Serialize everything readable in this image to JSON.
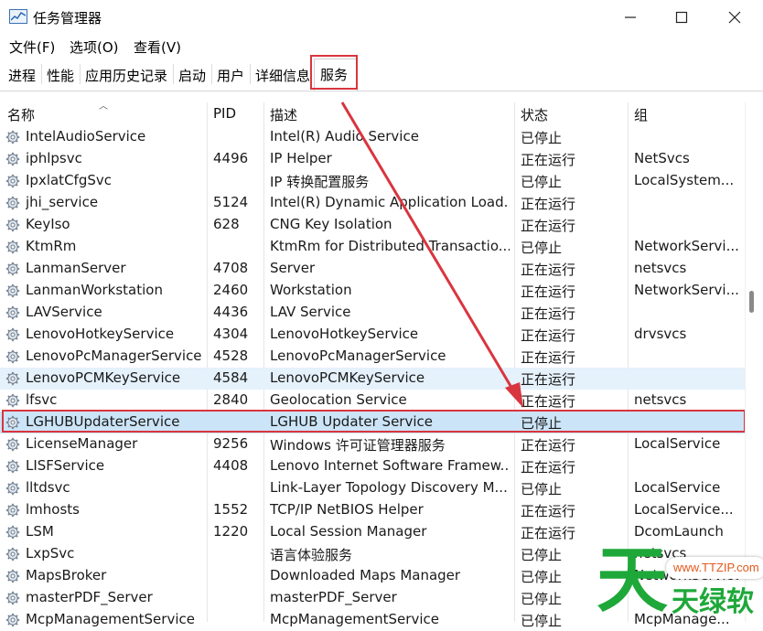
{
  "window": {
    "title": "任务管理器"
  },
  "menu": [
    "文件(F)",
    "选项(O)",
    "查看(V)"
  ],
  "tabs": [
    "进程",
    "性能",
    "应用历史记录",
    "启动",
    "用户",
    "详细信息",
    "服务"
  ],
  "active_tab": "服务",
  "columns": [
    "名称",
    "PID",
    "描述",
    "状态",
    "组"
  ],
  "rows": [
    {
      "name": "IntelAudioService",
      "pid": "",
      "desc": "Intel(R) Audio Service",
      "status": "已停止",
      "group": ""
    },
    {
      "name": "iphlpsvc",
      "pid": "4496",
      "desc": "IP Helper",
      "status": "正在运行",
      "group": "NetSvcs"
    },
    {
      "name": "IpxlatCfgSvc",
      "pid": "",
      "desc": "IP 转换配置服务",
      "status": "已停止",
      "group": "LocalSystem..."
    },
    {
      "name": "jhi_service",
      "pid": "5124",
      "desc": "Intel(R) Dynamic Application Load...",
      "status": "正在运行",
      "group": ""
    },
    {
      "name": "KeyIso",
      "pid": "628",
      "desc": "CNG Key Isolation",
      "status": "正在运行",
      "group": ""
    },
    {
      "name": "KtmRm",
      "pid": "",
      "desc": "KtmRm for Distributed Transactio...",
      "status": "已停止",
      "group": "NetworkServi..."
    },
    {
      "name": "LanmanServer",
      "pid": "4708",
      "desc": "Server",
      "status": "正在运行",
      "group": "netsvcs"
    },
    {
      "name": "LanmanWorkstation",
      "pid": "2460",
      "desc": "Workstation",
      "status": "正在运行",
      "group": "NetworkServi..."
    },
    {
      "name": "LAVService",
      "pid": "4436",
      "desc": "LAV Service",
      "status": "正在运行",
      "group": ""
    },
    {
      "name": "LenovoHotkeyService",
      "pid": "4304",
      "desc": "LenovoHotkeyService",
      "status": "正在运行",
      "group": "drvsvcs"
    },
    {
      "name": "LenovoPcManagerService",
      "pid": "4528",
      "desc": "LenovoPcManagerService",
      "status": "正在运行",
      "group": ""
    },
    {
      "name": "LenovoPCMKeyService",
      "pid": "4584",
      "desc": "LenovoPCMKeyService",
      "status": "正在运行",
      "group": ""
    },
    {
      "name": "lfsvc",
      "pid": "2840",
      "desc": "Geolocation Service",
      "status": "正在运行",
      "group": "netsvcs"
    },
    {
      "name": "LGHUBUpdaterService",
      "pid": "",
      "desc": "LGHUB Updater Service",
      "status": "已停止",
      "group": ""
    },
    {
      "name": "LicenseManager",
      "pid": "9256",
      "desc": "Windows 许可证管理器服务",
      "status": "正在运行",
      "group": "LocalService"
    },
    {
      "name": "LISFService",
      "pid": "4408",
      "desc": "Lenovo Internet Software Framew...",
      "status": "正在运行",
      "group": ""
    },
    {
      "name": "lltdsvc",
      "pid": "",
      "desc": "Link-Layer Topology Discovery M...",
      "status": "已停止",
      "group": "LocalService"
    },
    {
      "name": "lmhosts",
      "pid": "1552",
      "desc": "TCP/IP NetBIOS Helper",
      "status": "正在运行",
      "group": "LocalService..."
    },
    {
      "name": "LSM",
      "pid": "1220",
      "desc": "Local Session Manager",
      "status": "正在运行",
      "group": "DcomLaunch"
    },
    {
      "name": "LxpSvc",
      "pid": "",
      "desc": "语言体验服务",
      "status": "已停止",
      "group": "netsvcs"
    },
    {
      "name": "MapsBroker",
      "pid": "",
      "desc": "Downloaded Maps Manager",
      "status": "已停止",
      "group": "NetworkService"
    },
    {
      "name": "masterPDF_Server",
      "pid": "",
      "desc": "masterPDF_Server",
      "status": "已停止",
      "group": ""
    },
    {
      "name": "McpManagementService",
      "pid": "",
      "desc": "McpManagementService",
      "status": "已停止",
      "group": "McpManage..."
    }
  ],
  "selected_row": "LenovoPCMKeyService",
  "highlighted_row": "LGHUBUpdaterService",
  "colors": {
    "highlight_border": "#d9353f",
    "arrow": "#d9353f",
    "selected_bg": "#e5f1fb",
    "watermark_green": "#1fa83a",
    "watermark_orange": "#e25a1c"
  },
  "watermark": {
    "url": "www.TTZIP.com",
    "char": "天",
    "text": "天绿软"
  }
}
